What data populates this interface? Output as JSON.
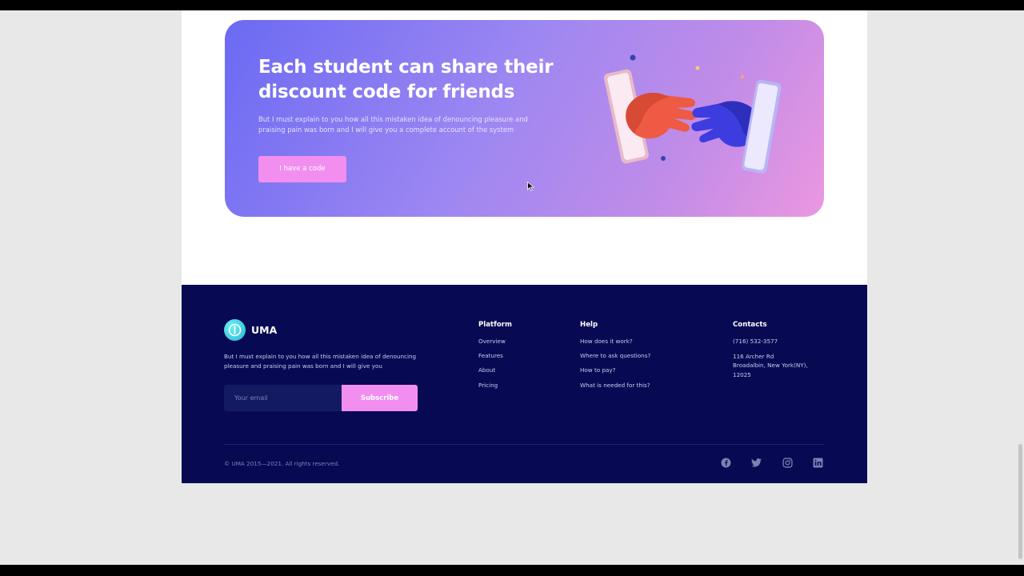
{
  "promo": {
    "title": "Each student can share their discount code for friends",
    "description": "But I must explain to you how all this mistaken idea of denouncing pleasure and praising pain was born and I will give you a complete account of the system",
    "button_label": "I have a code",
    "illustration_icon": "hands-reaching-through-phones-icon"
  },
  "footer": {
    "logo_text": "UMA",
    "description": "But I must explain to you how all this mistaken idea of denouncing pleasure and praising pain was born and I will give you",
    "email_placeholder": "Your email",
    "subscribe_label": "Subscribe",
    "platform": {
      "title": "Platform",
      "links": [
        "Overview",
        "Features",
        "About",
        "Pricing"
      ]
    },
    "help": {
      "title": "Help",
      "links": [
        "How does it work?",
        "Where to ask questions?",
        "How to pay?",
        "What is needed for this?"
      ]
    },
    "contacts": {
      "title": "Contacts",
      "phone": "(716) 532-3577",
      "address_line1": "116 Archer Rd",
      "address_line2": "Broadalbin, New York(NY),",
      "address_line3": "12025"
    },
    "copyright": "© UMA 2015—2021. All rights reserved.",
    "socials": [
      "facebook-icon",
      "twitter-icon",
      "instagram-icon",
      "linkedin-icon"
    ]
  },
  "colors": {
    "footer_bg": "#070a52",
    "accent_pink": "#f28ef0",
    "banner_gradient_start": "#6b6af3",
    "banner_gradient_end": "#ec97e0"
  }
}
